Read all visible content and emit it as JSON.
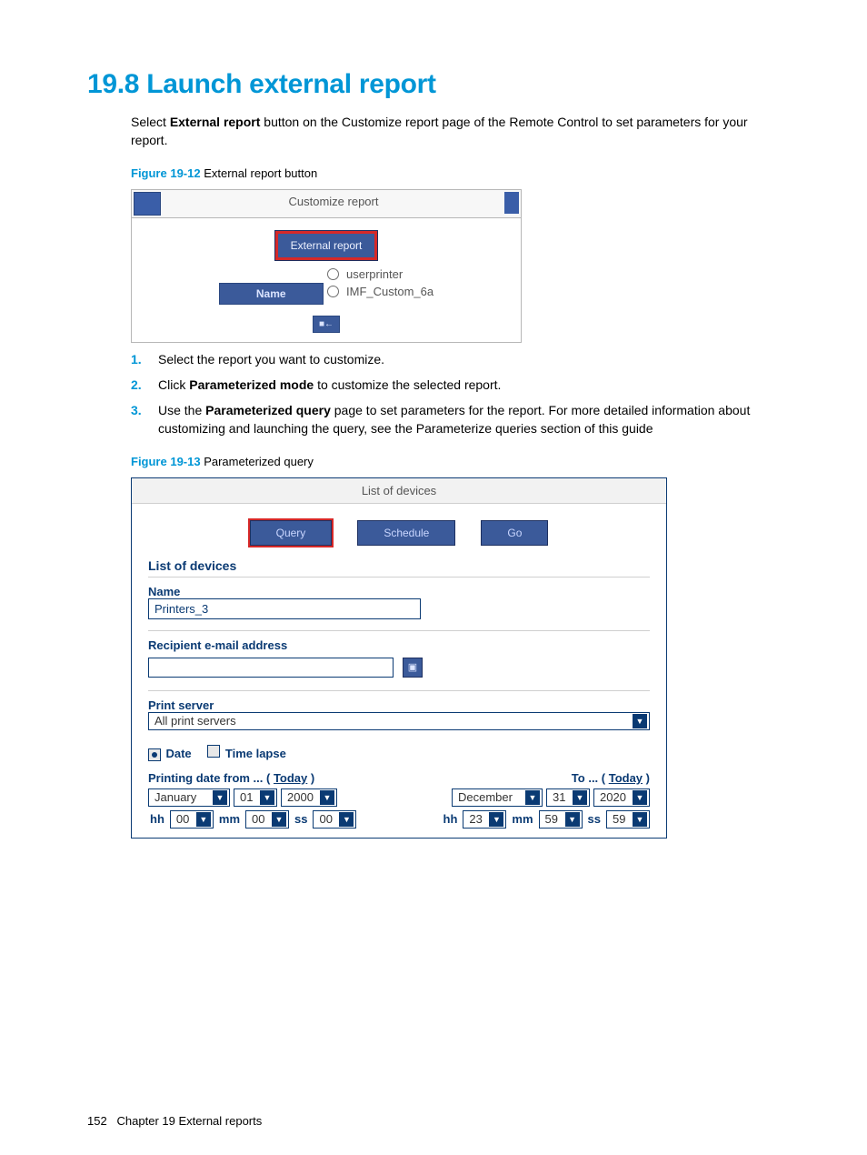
{
  "heading": "19.8 Launch external report",
  "intro_parts": [
    "Select ",
    "External report",
    " button on the Customize report page of the Remote Control to set parameters for your report."
  ],
  "figures": {
    "f1": {
      "num": "Figure 19-12",
      "title": "  External report button"
    },
    "f2": {
      "num": "Figure 19-13",
      "title": "  Parameterized query"
    }
  },
  "steps": [
    {
      "plain": "Select the report you want to customize."
    },
    {
      "pre": "Click ",
      "bold": "Parameterized mode",
      "post": " to customize the selected report."
    },
    {
      "pre": "Use the ",
      "bold": "Parameterized query",
      "post": " page to set parameters for the report. For more detailed information about customizing and launching the query, see the Parameterize queries section of this guide"
    }
  ],
  "shot1": {
    "titlebar": "Customize report",
    "button": "External report",
    "name_header": "Name",
    "options": [
      "userprinter",
      "IMF_Custom_6a"
    ],
    "small_btn": "■←"
  },
  "shot2": {
    "title": "List of devices",
    "buttons": {
      "query": "Query",
      "schedule": "Schedule",
      "go": "Go"
    },
    "list_header": "List of devices",
    "name_label": "Name",
    "name_value": "Printers_3",
    "email_label": "Recipient e-mail address",
    "addr_icon": "▣",
    "print_server_label": "Print server",
    "print_server_value": "All print servers",
    "date_radio_label": "Date",
    "time_radio_label": "Time lapse",
    "date_from_prefix": "Printing date from ... ( ",
    "date_to_prefix": "To ... ( ",
    "today_link": "Today",
    "close_paren": " )",
    "from": {
      "month": "January",
      "day": "01",
      "year": "2000",
      "hh": "00",
      "mm": "00",
      "ss": "00"
    },
    "to": {
      "month": "December",
      "day": "31",
      "year": "2020",
      "hh": "23",
      "mm": "59",
      "ss": "59"
    },
    "labels": {
      "hh": "hh",
      "mm": "mm",
      "ss": "ss"
    }
  },
  "footer": {
    "page": "152",
    "chapter": "Chapter 19   External reports"
  }
}
